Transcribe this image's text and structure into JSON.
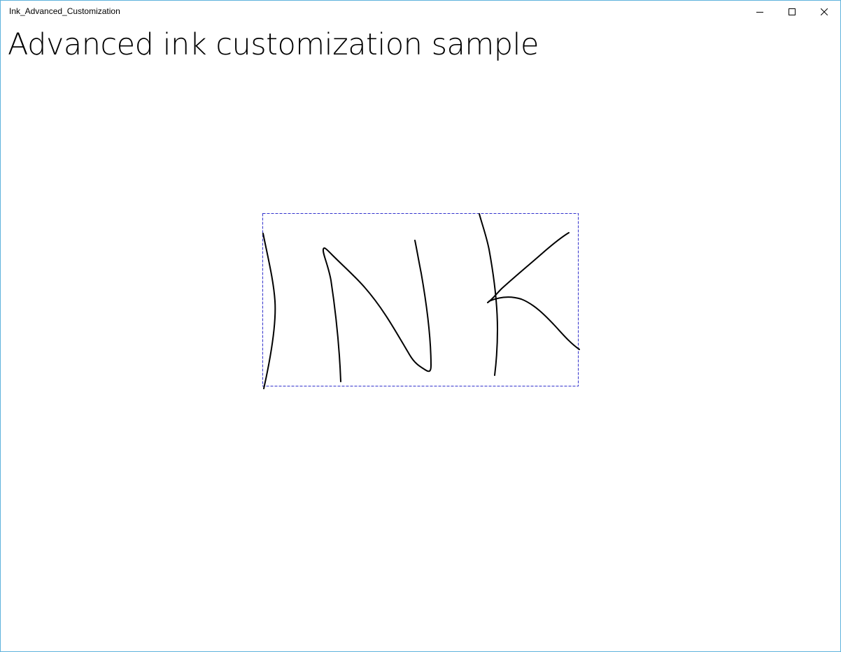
{
  "window": {
    "title": "Ink_Advanced_Customization",
    "buttons": {
      "minimize": "minimize-icon",
      "maximize": "maximize-icon",
      "close": "close-icon"
    }
  },
  "page": {
    "heading": "Advanced ink customization sample"
  },
  "ink": {
    "stroke_color": "#000000",
    "selection_color": "#3333cc",
    "selected_strokes": 5
  }
}
